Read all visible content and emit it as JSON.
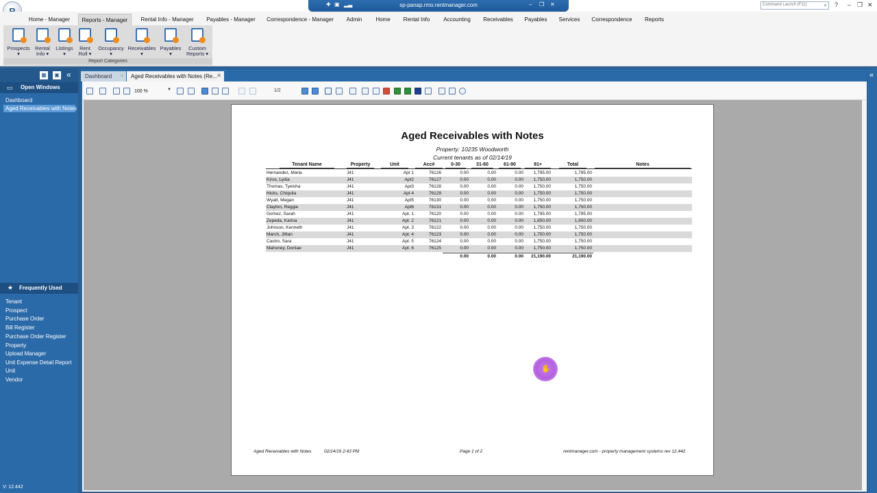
{
  "window": {
    "title": "sp-panap.rmo.rentmanager.com",
    "command_launch_placeholder": "Command Launch (F11)",
    "help_label": "?"
  },
  "menu": {
    "tabs": [
      "Home - Manager",
      "Reports - Manager",
      "Rental Info - Manager",
      "Payables - Manager",
      "Correspondence - Manager",
      "Admin",
      "Home",
      "Rental Info",
      "Accounting",
      "Receivables",
      "Payables",
      "Services",
      "Correspondence",
      "Reports"
    ],
    "active": "Reports - Manager"
  },
  "ribbon": {
    "items": [
      {
        "line1": "Prospects",
        "line2": "▾"
      },
      {
        "line1": "Rental",
        "line2": "Info ▾"
      },
      {
        "line1": "Listings",
        "line2": "▾"
      },
      {
        "line1": "Rent",
        "line2": "Roll ▾"
      },
      {
        "line1": "Occupancy",
        "line2": "▾"
      },
      {
        "line1": "Receivables",
        "line2": "▾"
      },
      {
        "line1": "Payables",
        "line2": "▾"
      },
      {
        "line1": "Custom",
        "line2": "Reports ▾"
      }
    ],
    "group_caption": "Report Categories"
  },
  "left_panel": {
    "open_windows_title": "Open Windows",
    "open_windows": [
      "Dashboard",
      "Aged Receivables with Notes"
    ],
    "frequently_used_title": "Frequently Used",
    "frequently_used": [
      "Tenant",
      "Prospect",
      "Purchase Order",
      "Bill Register",
      "Purchase Order Register",
      "Property",
      "Upload Manager",
      "Unit Expense Detail Report",
      "Unit",
      "Vendor"
    ],
    "version": "V: 12.442"
  },
  "doc_tabs": {
    "dashboard": "Dashboard",
    "report": "Aged Receivables with Notes (Re..."
  },
  "viewer": {
    "zoom": "100 %",
    "page_indicator": "1/2"
  },
  "report": {
    "title": "Aged Receivables with Notes",
    "property_line": "Property: 10235 Woodworth",
    "subtitle": "Current tenants as of 02/14/19",
    "columns": [
      "Tenant Name",
      "Property",
      "Unit",
      "Acc#",
      "0-30",
      "31-60",
      "61-90",
      "91+",
      "Total",
      "Notes"
    ],
    "rows": [
      {
        "name": "Hernandez, Maria",
        "property": "J41",
        "unit": "Apt 1",
        "acc": "76126",
        "d0": "0.00",
        "d31": "0.00",
        "d61": "0.00",
        "d91": "1,795.00",
        "total": "1,795.00",
        "notes": ""
      },
      {
        "name": "Kiros, Lydia",
        "property": "J41",
        "unit": "Apt2",
        "acc": "76127",
        "d0": "0.00",
        "d31": "0.00",
        "d61": "0.00",
        "d91": "1,750.00",
        "total": "1,750.00",
        "notes": ""
      },
      {
        "name": "Thomas, Tyeisha",
        "property": "J41",
        "unit": "Apt3",
        "acc": "76128",
        "d0": "0.00",
        "d31": "0.00",
        "d61": "0.00",
        "d91": "1,750.00",
        "total": "1,750.00",
        "notes": ""
      },
      {
        "name": "Hicks, Chiquita",
        "property": "J41",
        "unit": "Apt 4",
        "acc": "76129",
        "d0": "0.00",
        "d31": "0.00",
        "d61": "0.00",
        "d91": "1,750.00",
        "total": "1,750.00",
        "notes": ""
      },
      {
        "name": "Wyatt, Megan",
        "property": "J41",
        "unit": "Apt5",
        "acc": "76130",
        "d0": "0.00",
        "d31": "0.00",
        "d61": "0.00",
        "d91": "1,750.00",
        "total": "1,750.00",
        "notes": ""
      },
      {
        "name": "Clayton, Reggie",
        "property": "J41",
        "unit": "Apt6",
        "acc": "76131",
        "d0": "0.00",
        "d31": "0.00",
        "d61": "0.00",
        "d91": "1,750.00",
        "total": "1,750.00",
        "notes": ""
      },
      {
        "name": "Gomez, Sarah",
        "property": "J41",
        "unit": "Apt. 1",
        "acc": "76120",
        "d0": "0.00",
        "d31": "0.00",
        "d61": "0.00",
        "d91": "1,795.00",
        "total": "1,795.00",
        "notes": ""
      },
      {
        "name": "Zepeda, Karina",
        "property": "J41",
        "unit": "Apt. 2",
        "acc": "76121",
        "d0": "0.00",
        "d31": "0.00",
        "d61": "0.00",
        "d91": "1,850.00",
        "total": "1,850.00",
        "notes": ""
      },
      {
        "name": "Johnson, Kenneth",
        "property": "J41",
        "unit": "Apt. 3",
        "acc": "76122",
        "d0": "0.00",
        "d31": "0.00",
        "d61": "0.00",
        "d91": "1,750.00",
        "total": "1,750.00",
        "notes": ""
      },
      {
        "name": "March, Jillian",
        "property": "J41",
        "unit": "Apt. 4",
        "acc": "76123",
        "d0": "0.00",
        "d31": "0.00",
        "d61": "0.00",
        "d91": "1,750.00",
        "total": "1,750.00",
        "notes": ""
      },
      {
        "name": "Castro, Sara",
        "property": "J41",
        "unit": "Apt. 5",
        "acc": "76124",
        "d0": "0.00",
        "d31": "0.00",
        "d61": "0.00",
        "d91": "1,750.00",
        "total": "1,750.00",
        "notes": ""
      },
      {
        "name": "Mahoney, Dontae",
        "property": "J41",
        "unit": "Apt. 6",
        "acc": "76125",
        "d0": "0.00",
        "d31": "0.00",
        "d61": "0.00",
        "d91": "1,750.00",
        "total": "1,750.00",
        "notes": ""
      }
    ],
    "totals": {
      "d0": "0.00",
      "d31": "0.00",
      "d61": "0.00",
      "d91": "21,190.00",
      "total": "21,190.00"
    },
    "footer_left": "Aged Receivables with Notes",
    "footer_timestamp": "02/14/19 2:43 PM",
    "footer_page": "Page 1 of 2",
    "footer_right": "rentmanager.com - property management systems  rev 12.442"
  },
  "colors": {
    "shell_blue": "#2b6aa8",
    "accent_orange": "#f08c1e",
    "cursor_halo": "#b35fe0"
  }
}
